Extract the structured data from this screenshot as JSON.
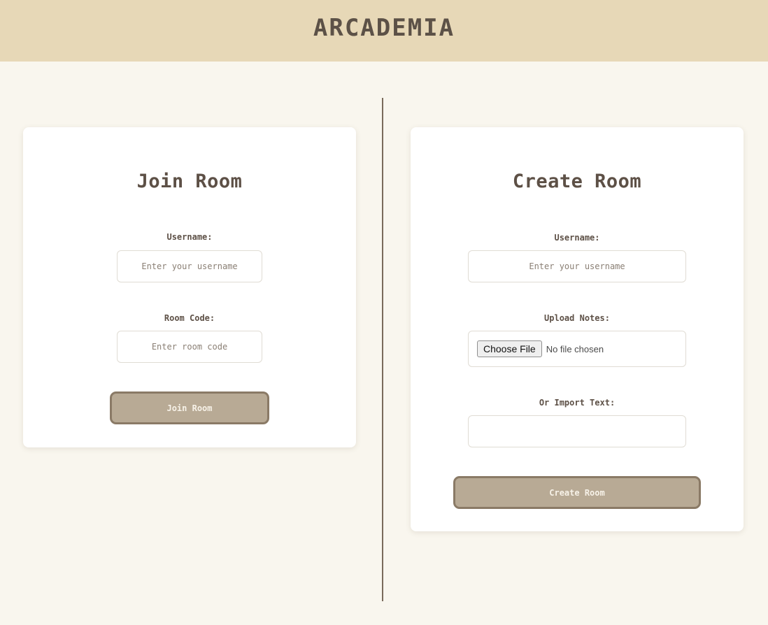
{
  "header": {
    "title": "ARCADEMIA"
  },
  "join_room": {
    "title": "Join Room",
    "username_label": "Username:",
    "username_placeholder": "Enter your username",
    "room_code_label": "Room Code:",
    "room_code_placeholder": "Enter room code",
    "submit_label": "Join Room"
  },
  "create_room": {
    "title": "Create Room",
    "username_label": "Username:",
    "username_placeholder": "Enter your username",
    "upload_label": "Upload Notes:",
    "file_button_label": "Choose File",
    "file_status": "No file chosen",
    "import_label": "Or Import Text:",
    "import_value": "",
    "submit_label": "Create Room"
  },
  "colors": {
    "page_background": "#f9f6ee",
    "header_background": "#e7d8b7",
    "button_fill": "#b8aa95",
    "button_border": "#8a7a66",
    "text": "#5d5046",
    "divider": "#7a6a5b"
  }
}
